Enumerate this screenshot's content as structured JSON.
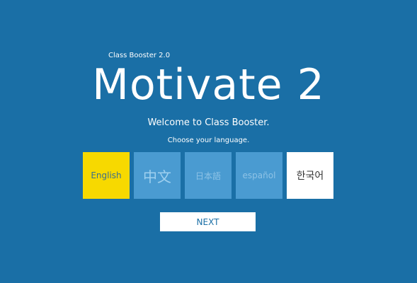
{
  "app": {
    "version_label": "Class Booster 2.0",
    "title": "Motivate 2",
    "welcome_text": "Welcome to Class Booster.",
    "prompt_text": "Choose your language."
  },
  "languages": [
    {
      "label": "English",
      "state": "selected"
    },
    {
      "label": "中文",
      "state": "disabled"
    },
    {
      "label": "日本語",
      "state": "disabled"
    },
    {
      "label": "español",
      "state": "disabled"
    },
    {
      "label": "한국어",
      "state": "available"
    }
  ],
  "actions": {
    "next_label": "NEXT"
  },
  "colors": {
    "background": "#1a6fa6",
    "selected": "#f7d900",
    "disabled_tile": "#4a9bd1",
    "available_tile": "#ffffff"
  }
}
